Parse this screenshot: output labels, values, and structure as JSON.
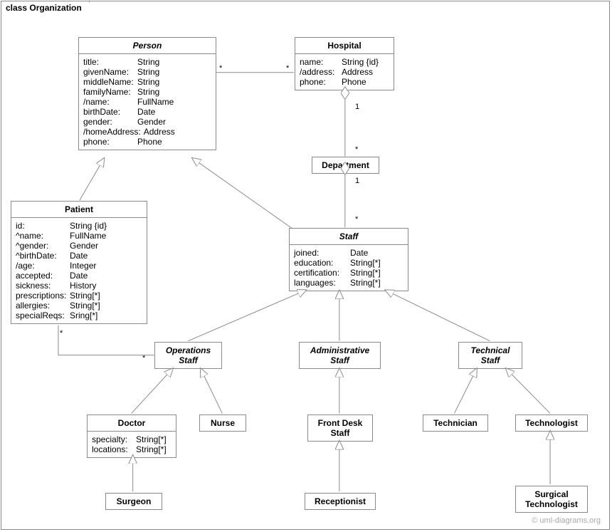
{
  "frame": {
    "title": "class Organization"
  },
  "watermark": "© uml-diagrams.org",
  "classes": {
    "person": {
      "name": "Person",
      "attrs": [
        {
          "n": "title:",
          "t": "String"
        },
        {
          "n": "givenName:",
          "t": "String"
        },
        {
          "n": "middleName:",
          "t": "String"
        },
        {
          "n": "familyName:",
          "t": "String"
        },
        {
          "n": "/name:",
          "t": "FullName"
        },
        {
          "n": "birthDate:",
          "t": "Date"
        },
        {
          "n": "gender:",
          "t": "Gender"
        },
        {
          "n": "/homeAddress:",
          "t": "Address"
        },
        {
          "n": "phone:",
          "t": "Phone"
        }
      ]
    },
    "hospital": {
      "name": "Hospital",
      "attrs": [
        {
          "n": "name:",
          "t": "String {id}"
        },
        {
          "n": "/address:",
          "t": "Address"
        },
        {
          "n": "phone:",
          "t": "Phone"
        }
      ]
    },
    "patient": {
      "name": "Patient",
      "attrs": [
        {
          "n": "id:",
          "t": "String {id}"
        },
        {
          "n": "^name:",
          "t": "FullName"
        },
        {
          "n": "^gender:",
          "t": "Gender"
        },
        {
          "n": "^birthDate:",
          "t": "Date"
        },
        {
          "n": "/age:",
          "t": "Integer"
        },
        {
          "n": "accepted:",
          "t": "Date"
        },
        {
          "n": "sickness:",
          "t": "History"
        },
        {
          "n": "prescriptions:",
          "t": "String[*]"
        },
        {
          "n": "allergies:",
          "t": "String[*]"
        },
        {
          "n": "specialReqs:",
          "t": "Sring[*]"
        }
      ]
    },
    "department": {
      "name": "Department"
    },
    "staff": {
      "name": "Staff",
      "attrs": [
        {
          "n": "joined:",
          "t": "Date"
        },
        {
          "n": "education:",
          "t": "String[*]"
        },
        {
          "n": "certification:",
          "t": "String[*]"
        },
        {
          "n": "languages:",
          "t": "String[*]"
        }
      ]
    },
    "opsStaff": {
      "name1": "Operations",
      "name2": "Staff"
    },
    "adminStaff": {
      "name1": "Administrative",
      "name2": "Staff"
    },
    "techStaff": {
      "name1": "Technical",
      "name2": "Staff"
    },
    "doctor": {
      "name": "Doctor",
      "attrs": [
        {
          "n": "specialty:",
          "t": "String[*]"
        },
        {
          "n": "locations:",
          "t": "String[*]"
        }
      ]
    },
    "nurse": {
      "name": "Nurse"
    },
    "frontDesk": {
      "name1": "Front Desk",
      "name2": "Staff"
    },
    "technician": {
      "name": "Technician"
    },
    "technologist": {
      "name": "Technologist"
    },
    "surgeon": {
      "name": "Surgeon"
    },
    "receptionist": {
      "name": "Receptionist"
    },
    "surgTech": {
      "name1": "Surgical",
      "name2": "Technologist"
    }
  },
  "mult": {
    "personHospL": "*",
    "personHospR": "*",
    "hospDept1": "1",
    "hospDeptStar": "*",
    "deptStaff1": "1",
    "deptStaffStar": "*",
    "patientOpsL": "*",
    "patientOpsR": "*"
  }
}
